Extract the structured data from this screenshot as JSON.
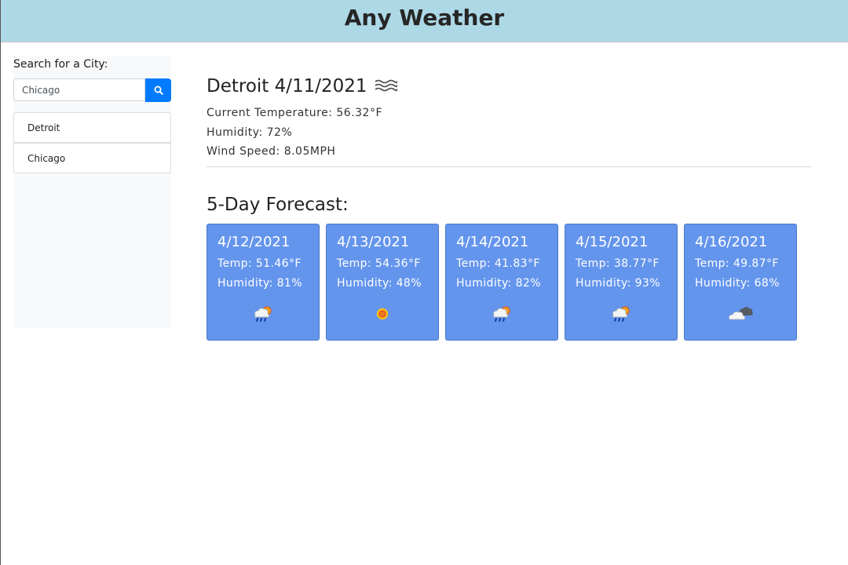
{
  "header": {
    "title": "Any Weather"
  },
  "sidebar": {
    "search_label": "Search for a City:",
    "search_value": "Chicago",
    "search_button_icon": "search-icon",
    "cities": [
      "Detroit",
      "Chicago"
    ]
  },
  "current": {
    "city_date": "Detroit 4/11/2021",
    "icon": "wind-icon",
    "temperature": "Current Temperature: 56.32°F",
    "humidity": "Humidity: 72%",
    "wind": "Wind Speed: 8.05MPH"
  },
  "forecast": {
    "title": "5-Day Forecast:",
    "days": [
      {
        "date": "4/12/2021",
        "temp": "Temp: 51.46°F",
        "humidity": "Humidity: 81%",
        "icon": "rain-sun-icon"
      },
      {
        "date": "4/13/2021",
        "temp": "Temp: 54.36°F",
        "humidity": "Humidity: 48%",
        "icon": "sun-icon"
      },
      {
        "date": "4/14/2021",
        "temp": "Temp: 41.83°F",
        "humidity": "Humidity: 82%",
        "icon": "rain-sun-icon"
      },
      {
        "date": "4/15/2021",
        "temp": "Temp: 38.77°F",
        "humidity": "Humidity: 93%",
        "icon": "rain-sun-icon"
      },
      {
        "date": "4/16/2021",
        "temp": "Temp: 49.87°F",
        "humidity": "Humidity: 68%",
        "icon": "cloudy-icon"
      }
    ]
  },
  "colors": {
    "header_bg": "#add8e6",
    "card_bg": "#6495ed",
    "button_bg": "#007bff"
  }
}
